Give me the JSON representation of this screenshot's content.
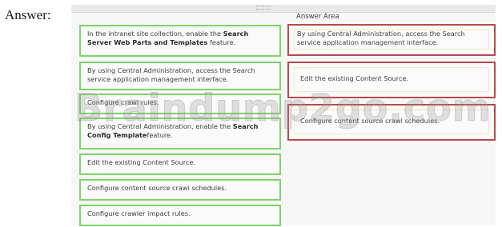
{
  "answer_label": "Answer:",
  "answer_area_title": "Answer Area",
  "watermark": "Braindump2go.com",
  "choices": [
    {
      "parts": [
        {
          "text": "In the intranet site collection, enable the ",
          "bold": false
        },
        {
          "text": "Search Server Web Parts and Templates",
          "bold": true
        },
        {
          "text": " feature.",
          "bold": false
        }
      ]
    },
    {
      "parts": [
        {
          "text": "By using Central Administration, access the Search service application management interface.",
          "bold": false
        }
      ]
    },
    {
      "parts": [
        {
          "text": "Configure crawl rules.",
          "bold": false
        }
      ]
    },
    {
      "parts": [
        {
          "text": "By using Central Administration, enable the ",
          "bold": false
        },
        {
          "text": "Search Config Template",
          "bold": true
        },
        {
          "text": "feature.",
          "bold": false
        }
      ]
    },
    {
      "parts": [
        {
          "text": "Edit the existing Content Source.",
          "bold": false
        }
      ]
    },
    {
      "parts": [
        {
          "text": "Configure content source crawl schedules.",
          "bold": false
        }
      ]
    },
    {
      "parts": [
        {
          "text": "Configure crawler impact rules.",
          "bold": false
        }
      ]
    }
  ],
  "answers": [
    "By using Central Administration, access the Search service application management interface.",
    "Edit the existing Content Source.",
    "Configure content source crawl schedules."
  ]
}
